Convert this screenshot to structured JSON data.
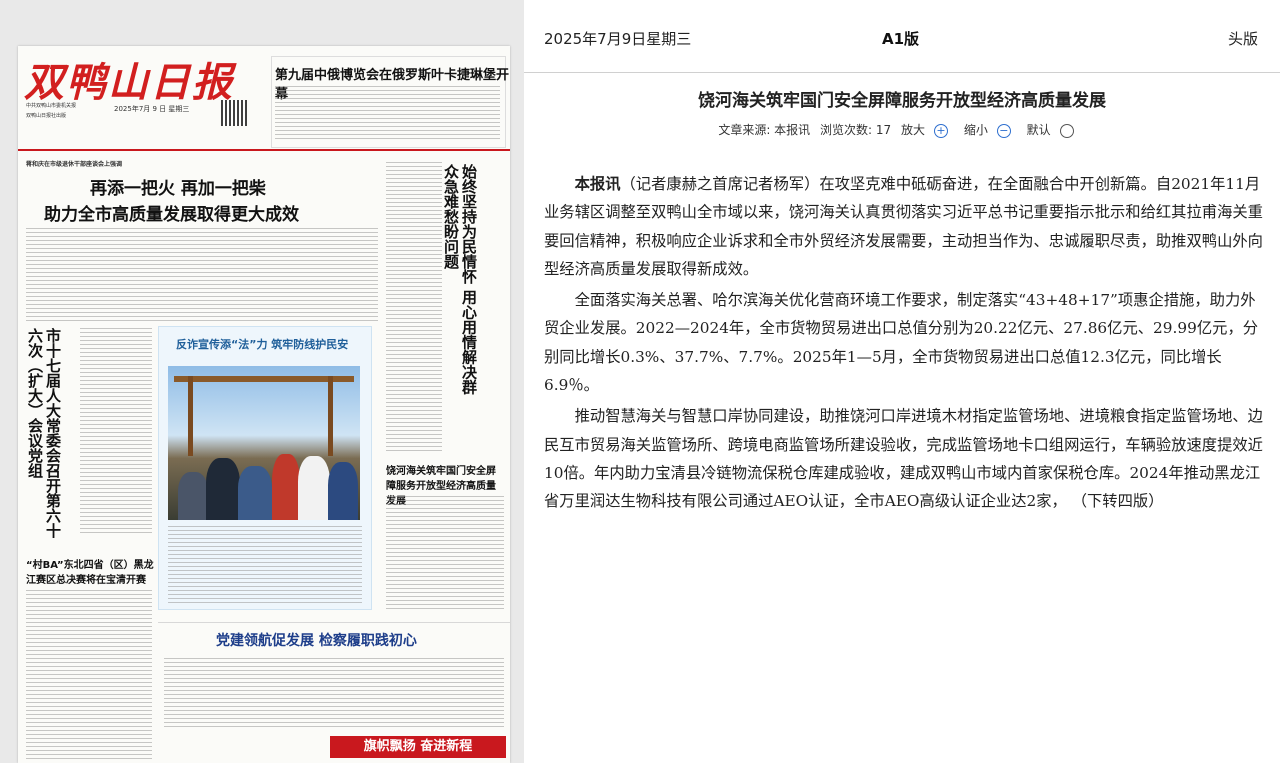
{
  "newspaper": {
    "masthead": "双鸭山日报",
    "masthead_sub": "中共双鸭山市委机关报",
    "masthead_sub2": "双鸭山日报社出版",
    "masthead_date": "2025年7月 9 日  星期三",
    "top_headline": "第九届中俄博览会在俄罗斯叶卡捷琳堡开幕",
    "kicker1": "蒋和庆在市级退休干部座谈会上强调",
    "lead_line1": "再添一把火   再加一把柴",
    "lead_line2": "助力全市高质量发展取得更大成效",
    "vert_right": "始终坚持为民情怀 用心用情解决群众急难愁盼问题",
    "vert_left": "市十七届人大常委会召开第六十六次（扩大）会议党组",
    "photo_caption_title": "反诈宣传添“法”力  筑牢防线护民安",
    "side_head": "饶河海关筑牢国门安全屏障服务开放型经济高质量发展",
    "left_bottom_head": "“村BA”东北四省（区）黑龙江赛区总决赛将在宝清开赛",
    "bottom_headline": "党建领航促发展  检察履职践初心",
    "banner": "旗帜飘扬 奋进新程"
  },
  "reader": {
    "date": "2025年7月9日星期三",
    "edition": "A1版",
    "section": "头版",
    "title": "饶河海关筑牢国门安全屏障服务开放型经济高质量发展",
    "source_label": "文章来源: 本报讯",
    "views_label": "浏览次数: 17",
    "zoom_in": "放大",
    "zoom_out": "缩小",
    "zoom_default": "默认",
    "lead": "本报讯",
    "para1_rest": "（记者康赫之首席记者杨军）在攻坚克难中砥砺奋进，在全面融合中开创新篇。自2021年11月业务辖区调整至双鸭山全市域以来，饶河海关认真贯彻落实习近平总书记重要指示批示和给红其拉甫海关重要回信精神，积极响应企业诉求和全市外贸经济发展需要，主动担当作为、忠诚履职尽责，助推双鸭山外向型经济高质量发展取得新成效。",
    "para2": "全面落实海关总署、哈尔滨海关优化营商环境工作要求，制定落实“43+48+17”项惠企措施，助力外贸企业发展。2022—2024年，全市货物贸易进出口总值分别为20.22亿元、27.86亿元、29.99亿元，分别同比增长0.3%、37.7%、7.7%。2025年1—5月，全市货物贸易进出口总值12.3亿元，同比增长6.9％。",
    "para3": "推动智慧海关与智慧口岸协同建设，助推饶河口岸进境木材指定监管场地、进境粮食指定监管场地、边民互市贸易海关监管场所、跨境电商监管场所建设验收，完成监管场地卡口组网运行，车辆验放速度提效近10倍。年内助力宝清县冷链物流保税仓库建成验收，建成双鸭山市域内首家保税仓库。2024年推动黑龙江省万里润达生物科技有限公司通过AEO认证，全市AEO高级认证企业达2家，  （下转四版）"
  },
  "colors": {
    "masthead_red": "#d21f1f",
    "link_blue": "#2e6fcf",
    "bottom_head_blue": "#1e3e8a"
  }
}
